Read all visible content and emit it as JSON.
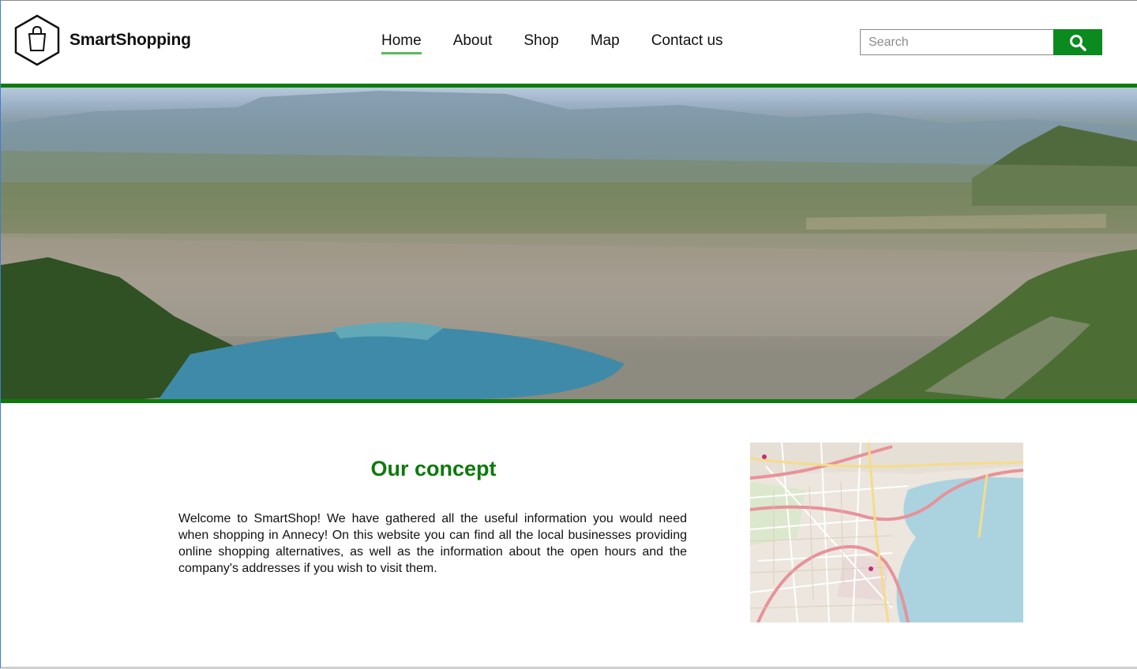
{
  "header": {
    "brand": "SmartShopping",
    "nav": [
      {
        "label": "Home",
        "active": true
      },
      {
        "label": "About",
        "active": false
      },
      {
        "label": "Shop",
        "active": false
      },
      {
        "label": "Map",
        "active": false
      },
      {
        "label": "Contact us",
        "active": false
      }
    ],
    "search": {
      "placeholder": "Search",
      "value": "",
      "button_icon": "search-icon"
    }
  },
  "hero": {
    "image": "aerial-city-lake-photo"
  },
  "concept": {
    "title": "Our concept",
    "text": "Welcome to SmartShop! We have gathered all the useful information you would need when shopping in Annecy! On this website you can find all the local businesses providing online shopping alternatives, as well as the information about the open hours and the company's addresses if you wish to visit them."
  },
  "map": {
    "image": "street-map-thumbnail"
  },
  "colors": {
    "accent": "#0d7a0d",
    "button": "#0a8a1f",
    "nav_underline": "#5cb85c",
    "title": "#0b7a0b"
  }
}
